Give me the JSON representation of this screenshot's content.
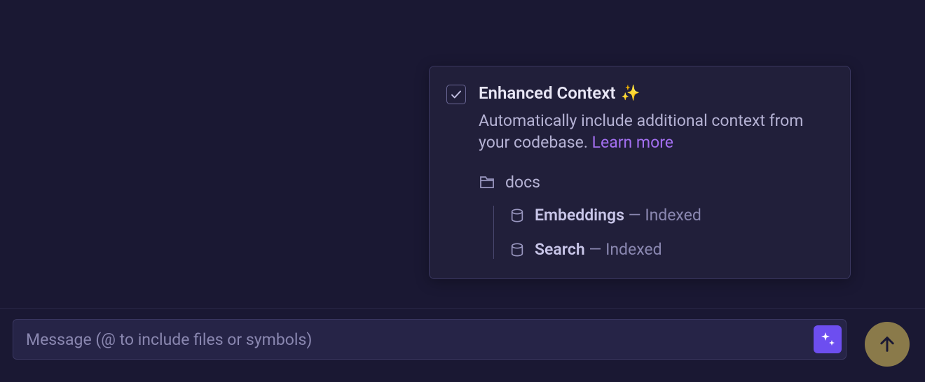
{
  "popup": {
    "title": "Enhanced Context",
    "sparkle": "✨",
    "description": "Automatically include additional context from your codebase.",
    "learn_more": "Learn more",
    "folder": "docs",
    "items": [
      {
        "name": "Embeddings",
        "status": "Indexed"
      },
      {
        "name": "Search",
        "status": "Indexed"
      }
    ],
    "dash": "—"
  },
  "input": {
    "placeholder": "Message (@ to include files or symbols)"
  }
}
